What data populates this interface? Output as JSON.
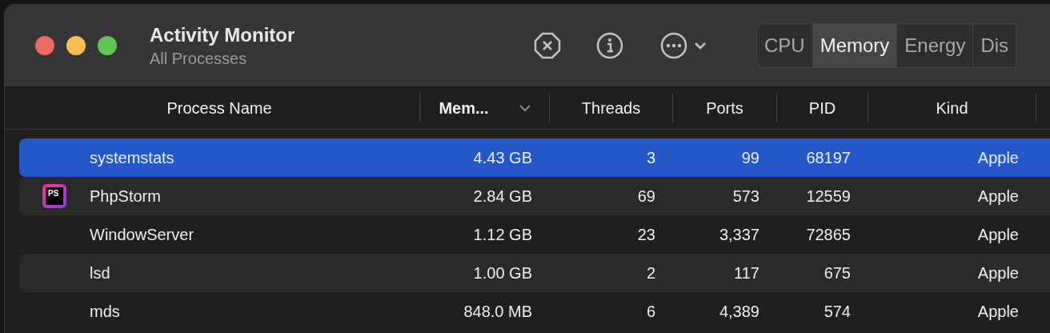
{
  "window": {
    "title": "Activity Monitor",
    "subtitle": "All Processes"
  },
  "tabs": [
    {
      "label": "CPU",
      "selected": false
    },
    {
      "label": "Memory",
      "selected": true
    },
    {
      "label": "Energy",
      "selected": false
    },
    {
      "label": "Dis",
      "selected": false
    }
  ],
  "table": {
    "columns": [
      {
        "label": "Process Name",
        "sorted": false
      },
      {
        "label": "Mem...",
        "sorted": true
      },
      {
        "label": "Threads",
        "sorted": false
      },
      {
        "label": "Ports",
        "sorted": false
      },
      {
        "label": "PID",
        "sorted": false
      },
      {
        "label": "Kind",
        "sorted": false
      }
    ],
    "rows": [
      {
        "selected": true,
        "badge": "",
        "cells": [
          "systemstats",
          "4.43 GB",
          "3",
          "99",
          "68197",
          "Apple"
        ]
      },
      {
        "selected": false,
        "badge": "PS",
        "cells": [
          "PhpStorm",
          "2.84 GB",
          "69",
          "573",
          "12559",
          "Apple"
        ]
      },
      {
        "selected": false,
        "badge": "",
        "cells": [
          "WindowServer",
          "1.12 GB",
          "23",
          "3,337",
          "72865",
          "Apple"
        ]
      },
      {
        "selected": false,
        "badge": "",
        "cells": [
          "lsd",
          "1.00 GB",
          "2",
          "117",
          "675",
          "Apple"
        ]
      },
      {
        "selected": false,
        "badge": "",
        "cells": [
          "mds",
          "848.0 MB",
          "6",
          "4,389",
          "574",
          "Apple"
        ]
      }
    ]
  }
}
